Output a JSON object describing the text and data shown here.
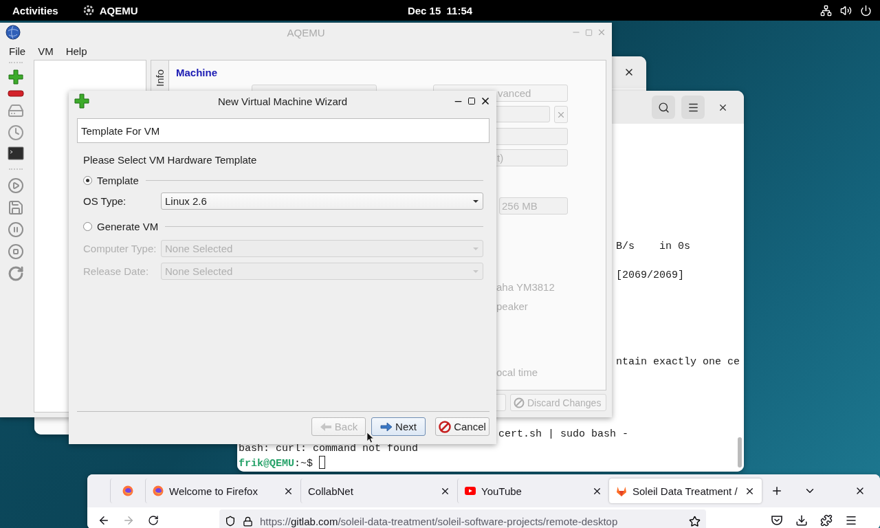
{
  "top_bar": {
    "activities": "Activities",
    "app_name": "AQEMU",
    "clock": "Dec 15  11:54"
  },
  "aqemu": {
    "title": "AQEMU",
    "menu": [
      "File",
      "VM",
      "Help"
    ],
    "side_tab": "Info",
    "section": "Machine",
    "advanced_button": "vanced",
    "combo_fragment": "t)",
    "memory": "256 MB",
    "fragments": [
      "aha YM3812",
      "peaker",
      "ocal time"
    ],
    "discard_button": {
      "label": "Discard Changes",
      "disabled": true
    }
  },
  "wizard": {
    "title": "New Virtual Machine Wizard",
    "header": "Template For VM",
    "prompt": "Please Select VM Hardware Template",
    "options": [
      {
        "label": "Template",
        "selected": true
      },
      {
        "label": "Generate VM",
        "selected": false
      }
    ],
    "os_type": {
      "label": "OS Type:",
      "value": "Linux 2.6"
    },
    "generate_fields": [
      {
        "label": "Computer Type:",
        "value": "None Selected",
        "disabled": true
      },
      {
        "label": "Release Date:",
        "value": "None Selected",
        "disabled": true
      }
    ],
    "buttons": [
      {
        "label": "Back",
        "kind": "back",
        "disabled": true,
        "default": false
      },
      {
        "label": "Next",
        "kind": "next",
        "disabled": false,
        "default": true
      },
      {
        "label": "Cancel",
        "kind": "cancel",
        "disabled": false,
        "default": false
      }
    ]
  },
  "terminal": {
    "lines": [
      "B/s    in 0s",
      "[2069/2069]",
      "ntain exactly one ce",
      "cert.sh | sudo bash -",
      "bash: curl: command not found"
    ],
    "prompt": {
      "user": "frik@QEMU",
      "path": ":~$"
    }
  },
  "firefox": {
    "tabs": [
      {
        "kind": "pinned",
        "selected": false
      },
      {
        "kind": "tab",
        "label": "Welcome to Firefox",
        "selected": false
      },
      {
        "kind": "tab",
        "label": "CollabNet",
        "selected": false
      },
      {
        "kind": "tab",
        "label": "YouTube",
        "selected": false
      },
      {
        "kind": "tab",
        "label": "Soleil Data Treatment /",
        "selected": true
      }
    ],
    "url": {
      "scheme": "https://",
      "host": "gitlab.com",
      "path": "/soleil-data-treatment/soleil-software-projects/remote-desktop"
    }
  }
}
